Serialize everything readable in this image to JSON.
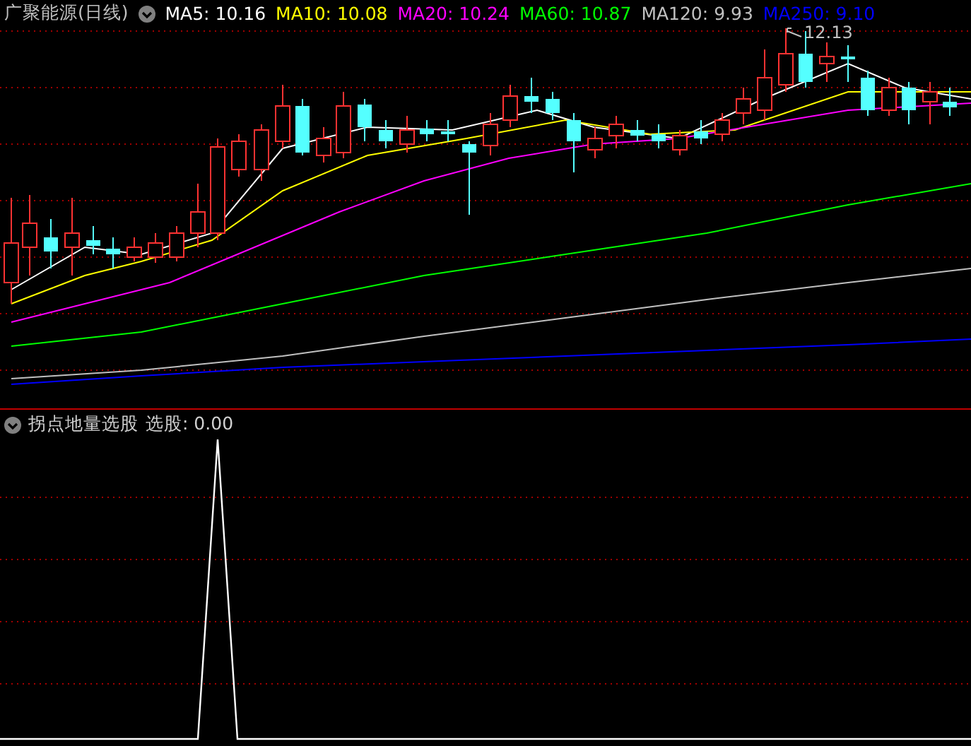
{
  "main_panel": {
    "title": "广聚能源(日线)",
    "indicators": [
      {
        "text": "MA5: 10.16",
        "color": "#ffffff"
      },
      {
        "text": "MA10: 10.08",
        "color": "#ffff00"
      },
      {
        "text": "MA20: 10.24",
        "color": "#ff00ff"
      },
      {
        "text": "MA60: 10.87",
        "color": "#00ff00"
      },
      {
        "text": "MA120: 9.93",
        "color": "#c0c0c0"
      },
      {
        "text": "MA250: 9.10",
        "color": "#0000ff"
      }
    ],
    "peak_label": "12.13"
  },
  "sub_panel": {
    "title": "拐点地量选股",
    "indicator": "选股: 0.00"
  }
}
